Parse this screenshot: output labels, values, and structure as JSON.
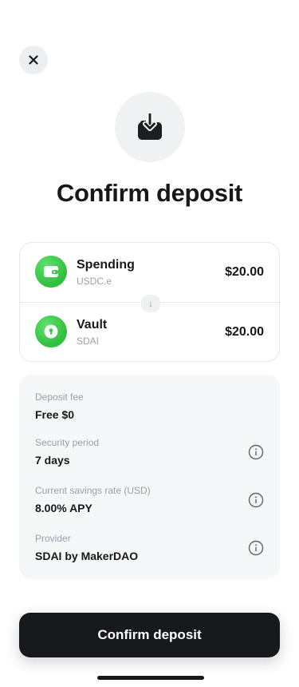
{
  "icons": {
    "close": "close-icon",
    "hero": "download-box-icon",
    "spending": "wallet-icon",
    "vault": "vault-icon",
    "arrow": "arrow-down-icon",
    "info": "info-icon"
  },
  "colors": {
    "accent_green": "#34c743",
    "button_bg": "#17191d",
    "details_bg": "#f6f7f9"
  },
  "title": "Confirm deposit",
  "transfer": {
    "from": {
      "name": "Spending",
      "token": "USDC.e",
      "amount": "$20.00"
    },
    "arrow": "↓",
    "to": {
      "name": "Vault",
      "token": "SDAI",
      "amount": "$20.00"
    }
  },
  "details": [
    {
      "label": "Deposit fee",
      "value": "Free $0"
    },
    {
      "label": "Security period",
      "value": "7 days"
    },
    {
      "label": "Current savings rate (USD)",
      "value": "8.00% APY"
    },
    {
      "label": "Provider",
      "value": "SDAI by MakerDAO"
    }
  ],
  "confirm_button": "Confirm deposit"
}
